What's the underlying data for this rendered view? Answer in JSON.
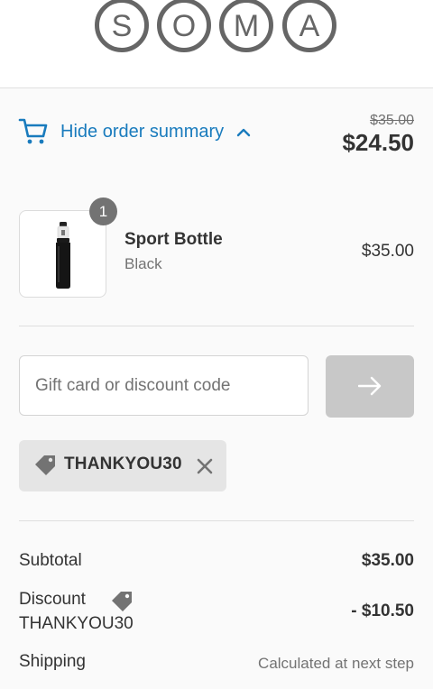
{
  "brand": {
    "logo_text": "SOMA"
  },
  "summary": {
    "toggle_label": "Hide order summary",
    "original_price": "$35.00",
    "total_price": "$24.50"
  },
  "product": {
    "quantity": "1",
    "name": "Sport Bottle",
    "variant": "Black",
    "price": "$35.00"
  },
  "discount_form": {
    "placeholder": "Gift card or discount code",
    "value": ""
  },
  "applied_code": {
    "code": "THANKYOU30"
  },
  "totals": {
    "subtotal_label": "Subtotal",
    "subtotal_value": "$35.00",
    "discount_label": "Discount",
    "discount_code": "THANKYOU30",
    "discount_value": "- $10.50",
    "shipping_label": "Shipping",
    "shipping_value": "Calculated at next step"
  },
  "colors": {
    "link": "#197bbd",
    "logo": "#666666",
    "button_disabled": "#c8c8c8"
  }
}
